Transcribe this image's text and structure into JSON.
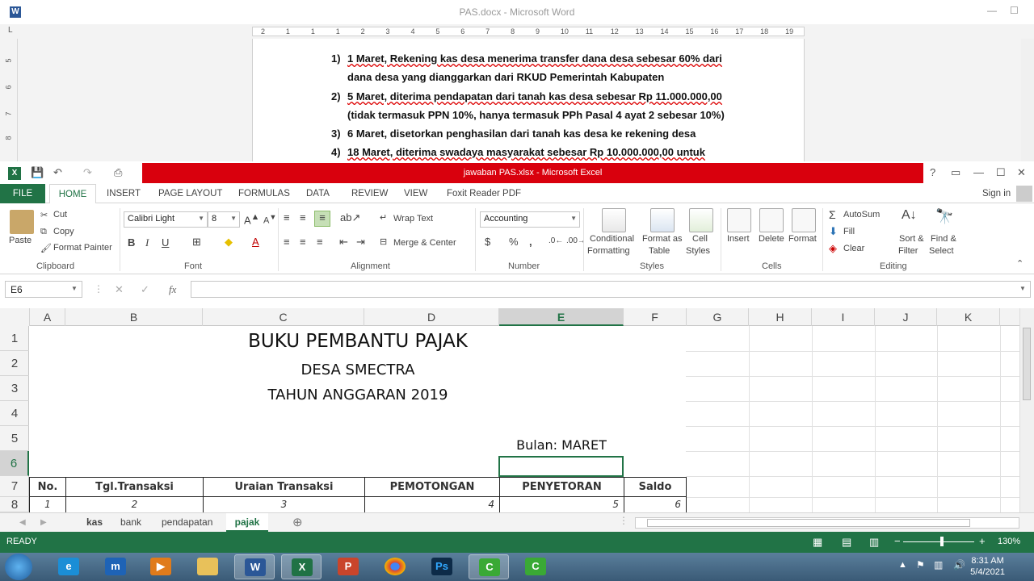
{
  "word": {
    "title": "PAS.docx - Microsoft Word",
    "ruler": [
      "2",
      "1",
      "1",
      "1",
      "2",
      "3",
      "4",
      "5",
      "6",
      "7",
      "8",
      "9",
      "10",
      "11",
      "12",
      "13",
      "14",
      "15",
      "16",
      "17",
      "18",
      "19"
    ],
    "vruler": [
      "5",
      "6",
      "7",
      "8"
    ],
    "lines": [
      {
        "num": "1)",
        "text": "1 Maret, Rekening kas desa menerima transfer dana desa sebesar 60% dari"
      },
      {
        "num": "",
        "text": "dana desa yang dianggarkan dari RKUD Pemerintah Kabupaten"
      },
      {
        "num": "2)",
        "text": "5 Maret, diterima pendapatan dari tanah kas desa sebesar Rp 11.000.000,00"
      },
      {
        "num": "",
        "text": "(tidak termasuk PPN 10%, hanya termasuk PPh Pasal 4 ayat 2 sebesar 10%)"
      },
      {
        "num": "3)",
        "text": "6 Maret, disetorkan penghasilan dari tanah kas desa ke rekening desa"
      },
      {
        "num": "4)",
        "text": "18 Maret, diterima swadaya masyarakat sebesar Rp 10.000.000,00 untuk"
      }
    ]
  },
  "excel": {
    "title": "jawaban PAS.xlsx -  Microsoft Excel",
    "signin": "Sign in",
    "tabs": [
      "FILE",
      "HOME",
      "INSERT",
      "PAGE LAYOUT",
      "FORMULAS",
      "DATA",
      "REVIEW",
      "VIEW",
      "Foxit Reader PDF"
    ],
    "clipboard": {
      "paste": "Paste",
      "cut": "Cut",
      "copy": "Copy",
      "format_painter": "Format Painter",
      "group": "Clipboard"
    },
    "font": {
      "name": "Calibri Light",
      "size": "8",
      "group": "Font",
      "bold": "B",
      "italic": "I",
      "underline": "U"
    },
    "alignment": {
      "wrap": "Wrap Text",
      "merge": "Merge & Center",
      "group": "Alignment"
    },
    "number": {
      "format": "Accounting",
      "group": "Number",
      "currency": "$",
      "percent": "%",
      "comma": ","
    },
    "styles": {
      "cond": "Conditional",
      "cond2": "Formatting",
      "fmt": "Format as",
      "fmt2": "Table",
      "cell": "Cell",
      "cell2": "Styles",
      "group": "Styles"
    },
    "cells": {
      "insert": "Insert",
      "delete": "Delete",
      "format": "Format",
      "group": "Cells"
    },
    "editing": {
      "autosum": "AutoSum",
      "fill": "Fill",
      "clear": "Clear",
      "sort": "Sort &",
      "sort2": "Filter",
      "find": "Find &",
      "find2": "Select",
      "group": "Editing"
    },
    "namebox": "E6",
    "fx": "fx",
    "columns": [
      "A",
      "B",
      "C",
      "D",
      "E",
      "F",
      "G",
      "H",
      "I",
      "J",
      "K"
    ],
    "rows": [
      "1",
      "2",
      "3",
      "4",
      "5",
      "6",
      "7",
      "8"
    ],
    "sheet": {
      "title": "BUKU PEMBANTU PAJAK",
      "subtitle": "DESA SMECTRA",
      "year": "TAHUN ANGGARAN 2019",
      "month": "Bulan: MARET",
      "headers": [
        "No.",
        "Tgl.Transaksi",
        "Uraian Transaksi",
        "PEMOTONGAN",
        "PENYETORAN",
        "Saldo"
      ],
      "numbers": [
        "1",
        "2",
        "3",
        "4",
        "5",
        "6"
      ]
    },
    "sheet_tabs": [
      "kas",
      "bank",
      "pendapatan",
      "pajak"
    ],
    "status": "READY",
    "zoom": "130%"
  },
  "taskbar": {
    "time": "8:31 AM",
    "date": "5/4/2021"
  }
}
